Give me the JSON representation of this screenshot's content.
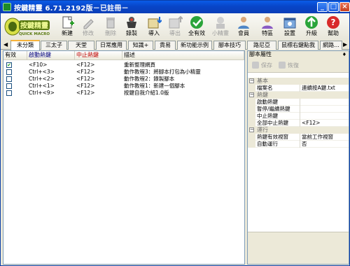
{
  "window": {
    "title": "按鍵精靈 6.71.2192版－已註冊－",
    "minimize": "_",
    "maximize": "□",
    "close": "×"
  },
  "logo": {
    "text_main": "按鍵精靈",
    "text_sub": "QUICK MACRO"
  },
  "toolbar": [
    {
      "name": "new",
      "label": "新建",
      "icon": "new-file-icon",
      "enabled": true
    },
    {
      "name": "edit",
      "label": "修改",
      "icon": "pencil-icon",
      "enabled": false
    },
    {
      "name": "delete",
      "label": "刪除",
      "icon": "trash-icon",
      "enabled": false
    },
    {
      "name": "record",
      "label": "錄製",
      "icon": "record-icon",
      "enabled": true
    },
    {
      "name": "import",
      "label": "導入",
      "icon": "import-icon",
      "enabled": true
    },
    {
      "name": "export",
      "label": "導出",
      "icon": "export-icon",
      "enabled": false
    },
    {
      "name": "all-enable",
      "label": "全有效",
      "icon": "check-icon",
      "enabled": true
    },
    {
      "name": "wizard",
      "label": "小精靈",
      "icon": "wizard-icon",
      "enabled": false
    },
    {
      "name": "member",
      "label": "會員",
      "icon": "member-icon",
      "enabled": true
    },
    {
      "name": "help",
      "label": "特區",
      "icon": "special-icon",
      "enabled": true
    },
    {
      "name": "settings",
      "label": "設置",
      "icon": "settings-icon",
      "enabled": true
    },
    {
      "name": "upgrade",
      "label": "升級",
      "icon": "upgrade-icon",
      "enabled": true
    },
    {
      "name": "about",
      "label": "幫助",
      "icon": "help-icon",
      "enabled": true
    }
  ],
  "tabs": [
    "未分類",
    "三太子",
    "天堂",
    "日常應用",
    "知識+",
    "貴易",
    "新功能示例",
    "腳本技巧",
    "路尼亞",
    "鼠標右鍵點我",
    "網路..."
  ],
  "list": {
    "headers": [
      "有效",
      "啟動熱鍵",
      "中止熱鍵",
      "描述"
    ],
    "rows": [
      {
        "checked": true,
        "start": "<F10>",
        "stop": "<F12>",
        "desc": "重新整理網頁"
      },
      {
        "checked": false,
        "start": "Ctrl+<3>",
        "stop": "<F12>",
        "desc": "動作教程3：將腳本打包為小精靈"
      },
      {
        "checked": false,
        "start": "Ctrl+<2>",
        "stop": "<F12>",
        "desc": "動作教程2：錄製腳本"
      },
      {
        "checked": false,
        "start": "Ctrl+<1>",
        "stop": "<F12>",
        "desc": "動作教程1：新建一個腳本"
      },
      {
        "checked": false,
        "start": "Ctrl+<9>",
        "stop": "<F12>",
        "desc": "按鍵自我介紹1.0版"
      }
    ]
  },
  "props": {
    "title": "腳本屬性",
    "pin": "♦",
    "save": "保存",
    "restore": "恢復",
    "sections": [
      {
        "name": "基本",
        "rows": [
          {
            "k": "檔案名",
            "v": "連續按A鍵.txt"
          }
        ]
      },
      {
        "name": "熱鍵",
        "rows": [
          {
            "k": "啟動熱鍵",
            "v": ""
          },
          {
            "k": "暫停/繼續熱鍵",
            "v": ""
          },
          {
            "k": "中止熱鍵",
            "v": ""
          },
          {
            "k": "全部中止熱鍵",
            "v": "<F12>"
          }
        ]
      },
      {
        "name": "運行",
        "rows": [
          {
            "k": "熱鍵有效視窗",
            "v": "當前工作視窗"
          },
          {
            "k": "自動運行",
            "v": "否"
          }
        ]
      }
    ]
  },
  "colors": {
    "title_bar": "#0845c8",
    "stop_header": "#c00000",
    "start_header": "#00007f",
    "active_tab": "#f7b33a"
  }
}
